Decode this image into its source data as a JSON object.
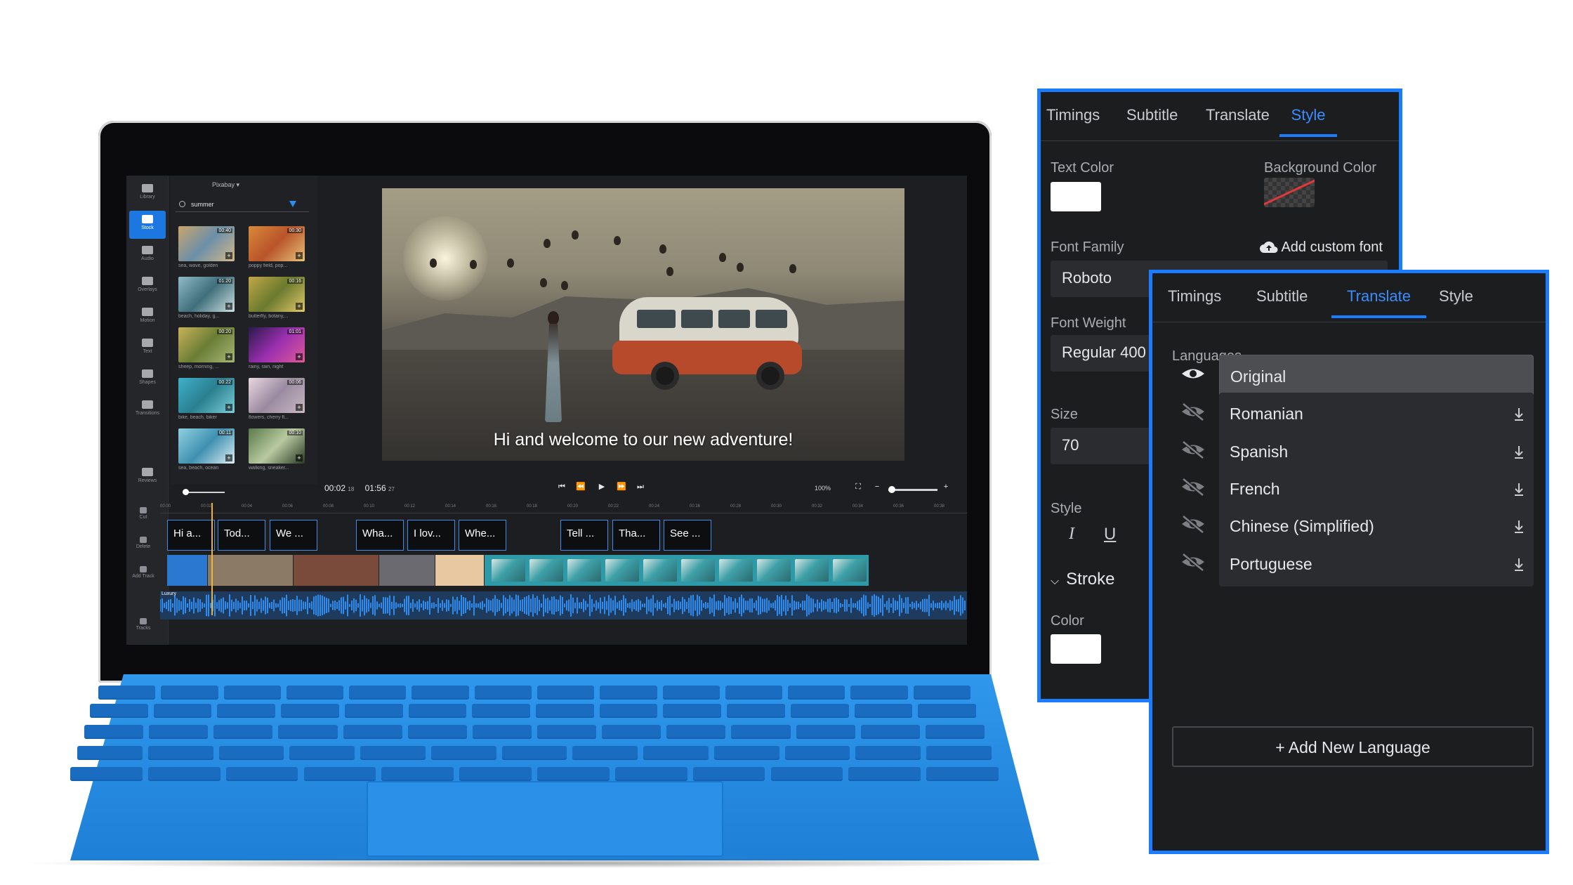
{
  "editor": {
    "rail": [
      "Library",
      "Stock",
      "Audio",
      "Overlays",
      "Motion",
      "Text",
      "Shapes",
      "Transitions",
      "Reviews"
    ],
    "source": "Pixabay",
    "search_value": "summer",
    "thumbs": [
      {
        "duration": "00:40",
        "caption": "sea, wave, golden"
      },
      {
        "duration": "00:30",
        "caption": "poppy field, pop..."
      },
      {
        "duration": "01:20",
        "caption": "beach, holiday, g..."
      },
      {
        "duration": "00:16",
        "caption": "butterfly, botany,..."
      },
      {
        "duration": "00:20",
        "caption": "sheep, morning, ..."
      },
      {
        "duration": "01:01",
        "caption": "rainy, rain, night"
      },
      {
        "duration": "00:22",
        "caption": "bike, beach, biker"
      },
      {
        "duration": "00:06",
        "caption": "flowers, cherry fl..."
      },
      {
        "duration": "00:11",
        "caption": "sea, beach, ocean"
      },
      {
        "duration": "00:10",
        "caption": "walking, sneaker..."
      }
    ],
    "subtitle_text": "Hi and welcome to our new adventure!",
    "timecode": "00:02",
    "timecode_frames": "18",
    "duration": "01:56",
    "duration_frames": "27",
    "zoom": "100%",
    "ruler": [
      "00:00",
      "00:02",
      "00:04",
      "00:06",
      "00:08",
      "00:10",
      "00:12",
      "00:14",
      "00:16",
      "00:18",
      "00:20",
      "00:22",
      "00:24",
      "00:26",
      "00:28",
      "00:30",
      "00:32",
      "00:34",
      "00:36",
      "00:38"
    ],
    "clips": [
      "Hi a...",
      "Tod...",
      "We ...",
      "Wha...",
      "I lov...",
      "Whe...",
      "Tell ...",
      "Tha...",
      "See ..."
    ],
    "audio_label": "Luxury",
    "tools": [
      "Cut",
      "Delete",
      "Add Track",
      "Tracks"
    ]
  },
  "style_panel": {
    "tabs": [
      "Timings",
      "Subtitle",
      "Translate",
      "Style"
    ],
    "active_tab": "Style",
    "text_color_label": "Text Color",
    "bg_color_label": "Background Color",
    "font_family_label": "Font Family",
    "add_font": "Add custom font",
    "font_family_value": "Roboto",
    "font_weight_label": "Font Weight",
    "font_weight_value": "Regular 400",
    "size_label": "Size",
    "size_value": "70",
    "style_label": "Style",
    "stroke_label": "Stroke",
    "color_label": "Color",
    "colors": {
      "text": "#ffffff",
      "stroke": "#ffffff",
      "accent": "#1a7cff"
    }
  },
  "translate_panel": {
    "tabs": [
      "Timings",
      "Subtitle",
      "Translate",
      "Style"
    ],
    "active_tab": "Translate",
    "languages_label": "Languages",
    "languages": [
      "Original",
      "Romanian",
      "Spanish",
      "French",
      "Chinese (Simplified)",
      "Portuguese"
    ],
    "add_language": "+ Add New Language"
  }
}
